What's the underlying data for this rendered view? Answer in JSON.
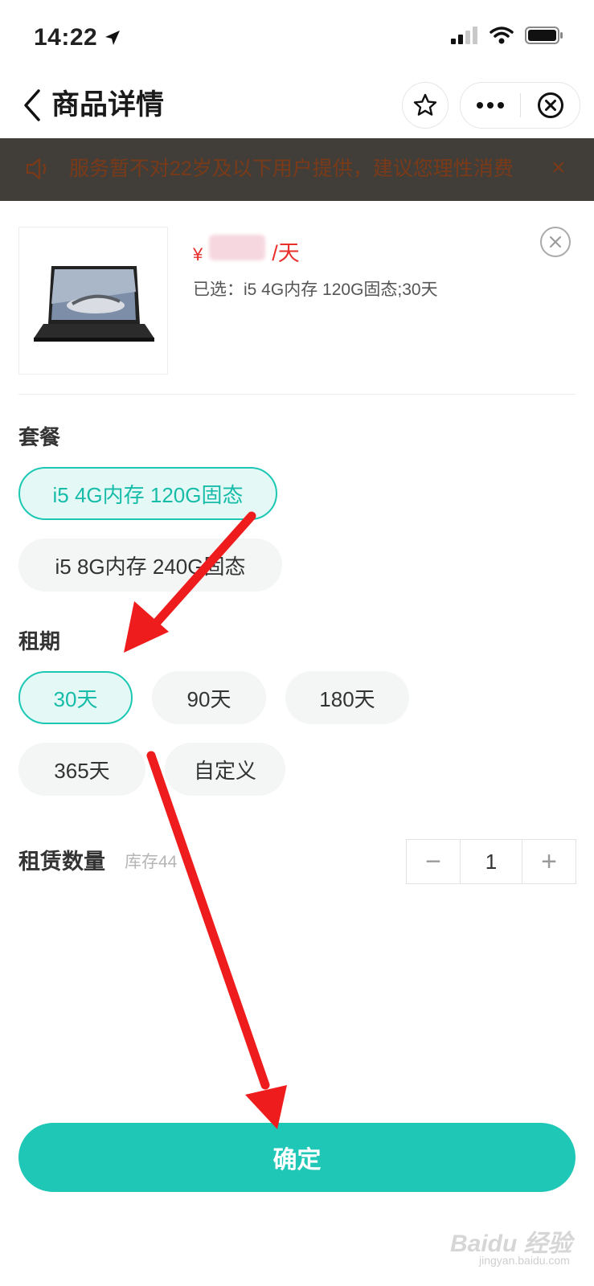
{
  "status_bar": {
    "time": "14:22",
    "icons": [
      "location-arrow-icon",
      "signal-icon",
      "wifi-icon",
      "battery-icon"
    ]
  },
  "nav": {
    "title": "商品详情",
    "icons": [
      "back-chevron-icon",
      "star-icon",
      "more-icon",
      "close-circle-icon"
    ]
  },
  "notice": {
    "text": "服务暂不对22岁及以下用户提供，建议您理性消费",
    "close": "×"
  },
  "product": {
    "price_symbol": "¥",
    "price_unit": "/天",
    "selected_text": "已选：i5 4G内存 120G固态;30天"
  },
  "package": {
    "label": "套餐",
    "options": [
      "i5 4G内存 120G固态",
      "i5 8G内存 240G固态"
    ],
    "selected": "i5 4G内存 120G固态"
  },
  "term": {
    "label": "租期",
    "options": [
      "30天",
      "90天",
      "180天",
      "365天",
      "自定义"
    ],
    "selected": "30天"
  },
  "quantity": {
    "label": "租赁数量",
    "stock": "库存44",
    "value": "1",
    "minus": "−",
    "plus": "+"
  },
  "confirm": {
    "label": "确定"
  },
  "watermark": {
    "text": "Baidu 经验",
    "sub": "jingyan.baidu.com"
  },
  "colors": {
    "accent": "#1ec7b6",
    "price": "#e8312c",
    "annotation_arrow": "#ee1c1c"
  }
}
